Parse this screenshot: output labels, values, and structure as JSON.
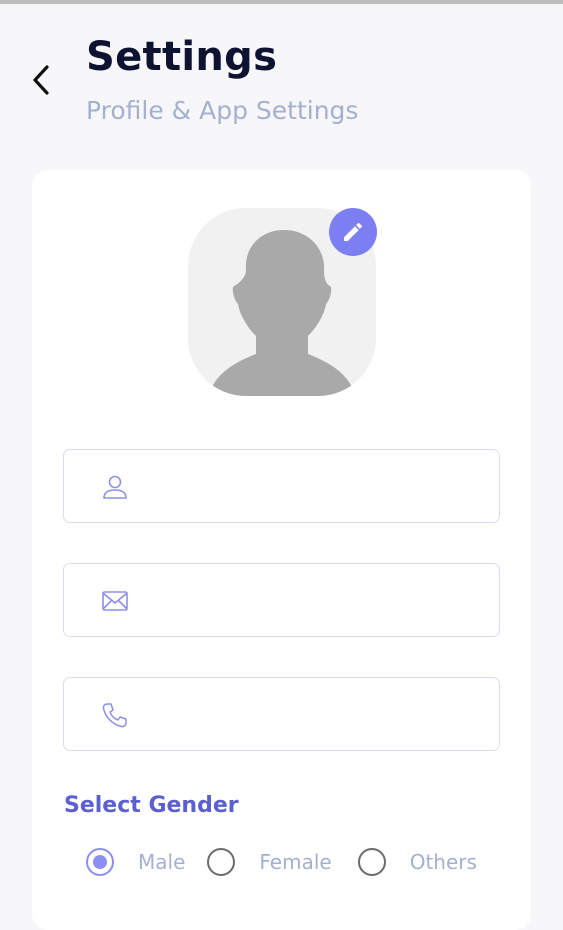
{
  "header": {
    "title": "Settings",
    "subtitle": "Profile & App Settings",
    "back_icon": "chevron-left-icon"
  },
  "profile": {
    "avatar_icon": "user-silhouette-icon",
    "edit_icon": "pencil-icon",
    "accent_color": "#7b7ff1"
  },
  "fields": {
    "name": {
      "icon": "user-icon",
      "value": "",
      "placeholder": ""
    },
    "email": {
      "icon": "mail-icon",
      "value": "",
      "placeholder": ""
    },
    "phone": {
      "icon": "phone-icon",
      "value": "",
      "placeholder": ""
    }
  },
  "gender": {
    "label": "Select Gender",
    "options": [
      "Male",
      "Female",
      "Others"
    ],
    "selected": "Male"
  },
  "colors": {
    "title": "#0d1330",
    "subtitle": "#a4b0d0",
    "accent": "#5b5fd0",
    "field_border": "#d8dbf5"
  }
}
